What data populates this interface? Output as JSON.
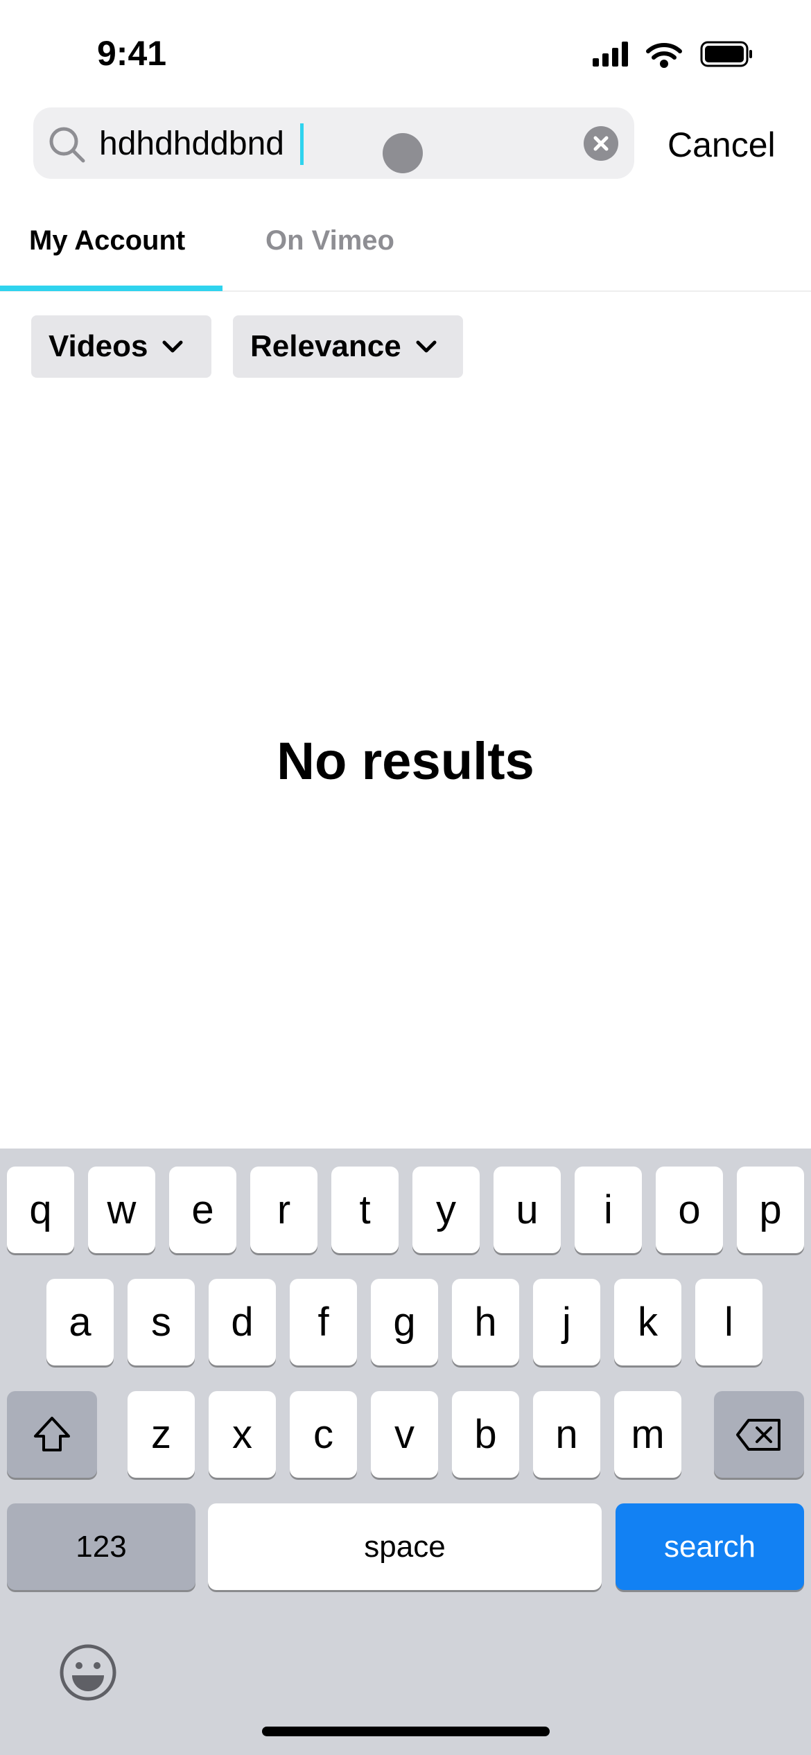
{
  "status_bar": {
    "time": "9:41"
  },
  "search": {
    "query": "hdhdhddbnd",
    "cancel_label": "Cancel"
  },
  "tabs": [
    {
      "label": "My Account",
      "active": true
    },
    {
      "label": "On Vimeo",
      "active": false
    }
  ],
  "filters": [
    {
      "label": "Videos"
    },
    {
      "label": "Relevance"
    }
  ],
  "empty_state": "No results",
  "keyboard": {
    "row1": [
      "q",
      "w",
      "e",
      "r",
      "t",
      "y",
      "u",
      "i",
      "o",
      "p"
    ],
    "row2": [
      "a",
      "s",
      "d",
      "f",
      "g",
      "h",
      "j",
      "k",
      "l"
    ],
    "row3": [
      "z",
      "x",
      "c",
      "v",
      "b",
      "n",
      "m"
    ],
    "numbers_label": "123",
    "space_label": "space",
    "search_label": "search"
  },
  "colors": {
    "accent": "#2fd3ee",
    "search_key": "#1281f3"
  }
}
